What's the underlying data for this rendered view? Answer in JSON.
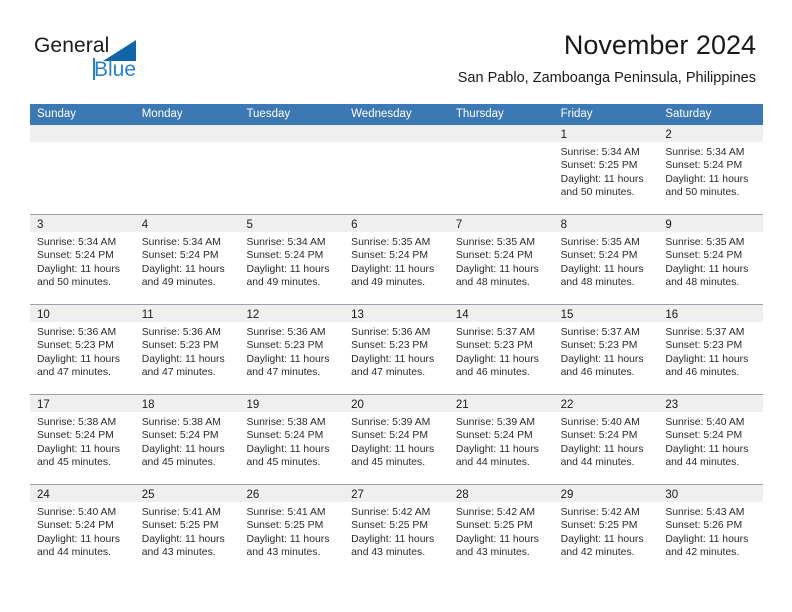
{
  "brand": {
    "name_part1": "General",
    "name_part2": "Blue",
    "triangle_color": "#1264a8",
    "blue_color": "#2a83c8"
  },
  "header": {
    "month_title": "November 2024",
    "location": "San Pablo, Zamboanga Peninsula, Philippines"
  },
  "calendar": {
    "header_bg": "#3c78b4",
    "daynum_band_bg": "#efefef",
    "weekday_headers": [
      "Sunday",
      "Monday",
      "Tuesday",
      "Wednesday",
      "Thursday",
      "Friday",
      "Saturday"
    ],
    "weeks": [
      [
        {
          "day": "",
          "empty": true
        },
        {
          "day": "",
          "empty": true
        },
        {
          "day": "",
          "empty": true
        },
        {
          "day": "",
          "empty": true
        },
        {
          "day": "",
          "empty": true
        },
        {
          "day": "1",
          "sunrise": "Sunrise: 5:34 AM",
          "sunset": "Sunset: 5:25 PM",
          "daylight_line1": "Daylight: 11 hours",
          "daylight_line2": "and 50 minutes."
        },
        {
          "day": "2",
          "sunrise": "Sunrise: 5:34 AM",
          "sunset": "Sunset: 5:24 PM",
          "daylight_line1": "Daylight: 11 hours",
          "daylight_line2": "and 50 minutes."
        }
      ],
      [
        {
          "day": "3",
          "sunrise": "Sunrise: 5:34 AM",
          "sunset": "Sunset: 5:24 PM",
          "daylight_line1": "Daylight: 11 hours",
          "daylight_line2": "and 50 minutes."
        },
        {
          "day": "4",
          "sunrise": "Sunrise: 5:34 AM",
          "sunset": "Sunset: 5:24 PM",
          "daylight_line1": "Daylight: 11 hours",
          "daylight_line2": "and 49 minutes."
        },
        {
          "day": "5",
          "sunrise": "Sunrise: 5:34 AM",
          "sunset": "Sunset: 5:24 PM",
          "daylight_line1": "Daylight: 11 hours",
          "daylight_line2": "and 49 minutes."
        },
        {
          "day": "6",
          "sunrise": "Sunrise: 5:35 AM",
          "sunset": "Sunset: 5:24 PM",
          "daylight_line1": "Daylight: 11 hours",
          "daylight_line2": "and 49 minutes."
        },
        {
          "day": "7",
          "sunrise": "Sunrise: 5:35 AM",
          "sunset": "Sunset: 5:24 PM",
          "daylight_line1": "Daylight: 11 hours",
          "daylight_line2": "and 48 minutes."
        },
        {
          "day": "8",
          "sunrise": "Sunrise: 5:35 AM",
          "sunset": "Sunset: 5:24 PM",
          "daylight_line1": "Daylight: 11 hours",
          "daylight_line2": "and 48 minutes."
        },
        {
          "day": "9",
          "sunrise": "Sunrise: 5:35 AM",
          "sunset": "Sunset: 5:24 PM",
          "daylight_line1": "Daylight: 11 hours",
          "daylight_line2": "and 48 minutes."
        }
      ],
      [
        {
          "day": "10",
          "sunrise": "Sunrise: 5:36 AM",
          "sunset": "Sunset: 5:23 PM",
          "daylight_line1": "Daylight: 11 hours",
          "daylight_line2": "and 47 minutes."
        },
        {
          "day": "11",
          "sunrise": "Sunrise: 5:36 AM",
          "sunset": "Sunset: 5:23 PM",
          "daylight_line1": "Daylight: 11 hours",
          "daylight_line2": "and 47 minutes."
        },
        {
          "day": "12",
          "sunrise": "Sunrise: 5:36 AM",
          "sunset": "Sunset: 5:23 PM",
          "daylight_line1": "Daylight: 11 hours",
          "daylight_line2": "and 47 minutes."
        },
        {
          "day": "13",
          "sunrise": "Sunrise: 5:36 AM",
          "sunset": "Sunset: 5:23 PM",
          "daylight_line1": "Daylight: 11 hours",
          "daylight_line2": "and 47 minutes."
        },
        {
          "day": "14",
          "sunrise": "Sunrise: 5:37 AM",
          "sunset": "Sunset: 5:23 PM",
          "daylight_line1": "Daylight: 11 hours",
          "daylight_line2": "and 46 minutes."
        },
        {
          "day": "15",
          "sunrise": "Sunrise: 5:37 AM",
          "sunset": "Sunset: 5:23 PM",
          "daylight_line1": "Daylight: 11 hours",
          "daylight_line2": "and 46 minutes."
        },
        {
          "day": "16",
          "sunrise": "Sunrise: 5:37 AM",
          "sunset": "Sunset: 5:23 PM",
          "daylight_line1": "Daylight: 11 hours",
          "daylight_line2": "and 46 minutes."
        }
      ],
      [
        {
          "day": "17",
          "sunrise": "Sunrise: 5:38 AM",
          "sunset": "Sunset: 5:24 PM",
          "daylight_line1": "Daylight: 11 hours",
          "daylight_line2": "and 45 minutes."
        },
        {
          "day": "18",
          "sunrise": "Sunrise: 5:38 AM",
          "sunset": "Sunset: 5:24 PM",
          "daylight_line1": "Daylight: 11 hours",
          "daylight_line2": "and 45 minutes."
        },
        {
          "day": "19",
          "sunrise": "Sunrise: 5:38 AM",
          "sunset": "Sunset: 5:24 PM",
          "daylight_line1": "Daylight: 11 hours",
          "daylight_line2": "and 45 minutes."
        },
        {
          "day": "20",
          "sunrise": "Sunrise: 5:39 AM",
          "sunset": "Sunset: 5:24 PM",
          "daylight_line1": "Daylight: 11 hours",
          "daylight_line2": "and 45 minutes."
        },
        {
          "day": "21",
          "sunrise": "Sunrise: 5:39 AM",
          "sunset": "Sunset: 5:24 PM",
          "daylight_line1": "Daylight: 11 hours",
          "daylight_line2": "and 44 minutes."
        },
        {
          "day": "22",
          "sunrise": "Sunrise: 5:40 AM",
          "sunset": "Sunset: 5:24 PM",
          "daylight_line1": "Daylight: 11 hours",
          "daylight_line2": "and 44 minutes."
        },
        {
          "day": "23",
          "sunrise": "Sunrise: 5:40 AM",
          "sunset": "Sunset: 5:24 PM",
          "daylight_line1": "Daylight: 11 hours",
          "daylight_line2": "and 44 minutes."
        }
      ],
      [
        {
          "day": "24",
          "sunrise": "Sunrise: 5:40 AM",
          "sunset": "Sunset: 5:24 PM",
          "daylight_line1": "Daylight: 11 hours",
          "daylight_line2": "and 44 minutes."
        },
        {
          "day": "25",
          "sunrise": "Sunrise: 5:41 AM",
          "sunset": "Sunset: 5:25 PM",
          "daylight_line1": "Daylight: 11 hours",
          "daylight_line2": "and 43 minutes."
        },
        {
          "day": "26",
          "sunrise": "Sunrise: 5:41 AM",
          "sunset": "Sunset: 5:25 PM",
          "daylight_line1": "Daylight: 11 hours",
          "daylight_line2": "and 43 minutes."
        },
        {
          "day": "27",
          "sunrise": "Sunrise: 5:42 AM",
          "sunset": "Sunset: 5:25 PM",
          "daylight_line1": "Daylight: 11 hours",
          "daylight_line2": "and 43 minutes."
        },
        {
          "day": "28",
          "sunrise": "Sunrise: 5:42 AM",
          "sunset": "Sunset: 5:25 PM",
          "daylight_line1": "Daylight: 11 hours",
          "daylight_line2": "and 43 minutes."
        },
        {
          "day": "29",
          "sunrise": "Sunrise: 5:42 AM",
          "sunset": "Sunset: 5:25 PM",
          "daylight_line1": "Daylight: 11 hours",
          "daylight_line2": "and 42 minutes."
        },
        {
          "day": "30",
          "sunrise": "Sunrise: 5:43 AM",
          "sunset": "Sunset: 5:26 PM",
          "daylight_line1": "Daylight: 11 hours",
          "daylight_line2": "and 42 minutes."
        }
      ]
    ]
  }
}
